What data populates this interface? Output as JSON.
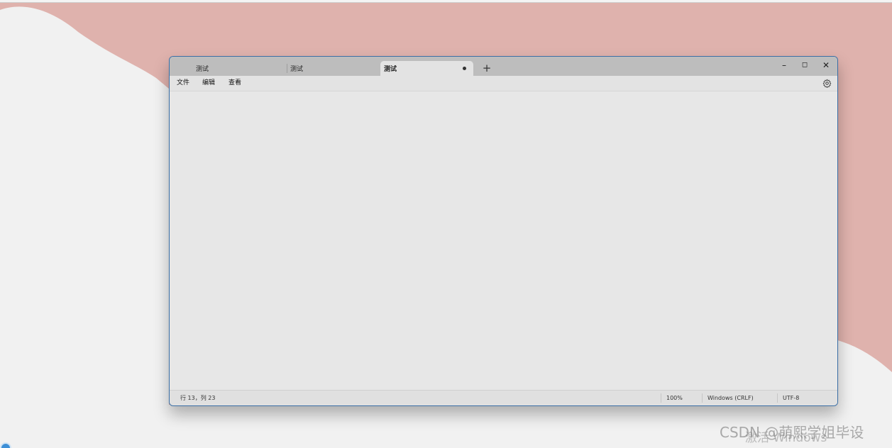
{
  "colors": {
    "wallpaper": "#dfb2ad",
    "wallpaper_light": "#f1f1f1",
    "window_border": "#3a6ea5",
    "titlebar": "#bdbdbd",
    "editor_bg": "#e7e7e7"
  },
  "tabs": [
    {
      "label": "测试",
      "active": false
    },
    {
      "label": "测试",
      "active": false
    },
    {
      "label": "测试",
      "active": true,
      "unsaved_indicator": "dot"
    }
  ],
  "new_tab": {
    "label": "+"
  },
  "window_controls": {
    "minimize": "–",
    "maximize": "◻",
    "close": "✕"
  },
  "menu": {
    "file": "文件",
    "edit": "编辑",
    "view": "查看",
    "settings_icon": "gear-icon"
  },
  "editor": {
    "content": ""
  },
  "status": {
    "position": "行 13，列 23",
    "zoom": "100%",
    "line_ending": "Windows (CRLF)",
    "encoding": "UTF-8"
  },
  "desktop": {
    "activation_text": "激活 Windows",
    "watermark": "CSDN @萌熙学姐毕设"
  }
}
